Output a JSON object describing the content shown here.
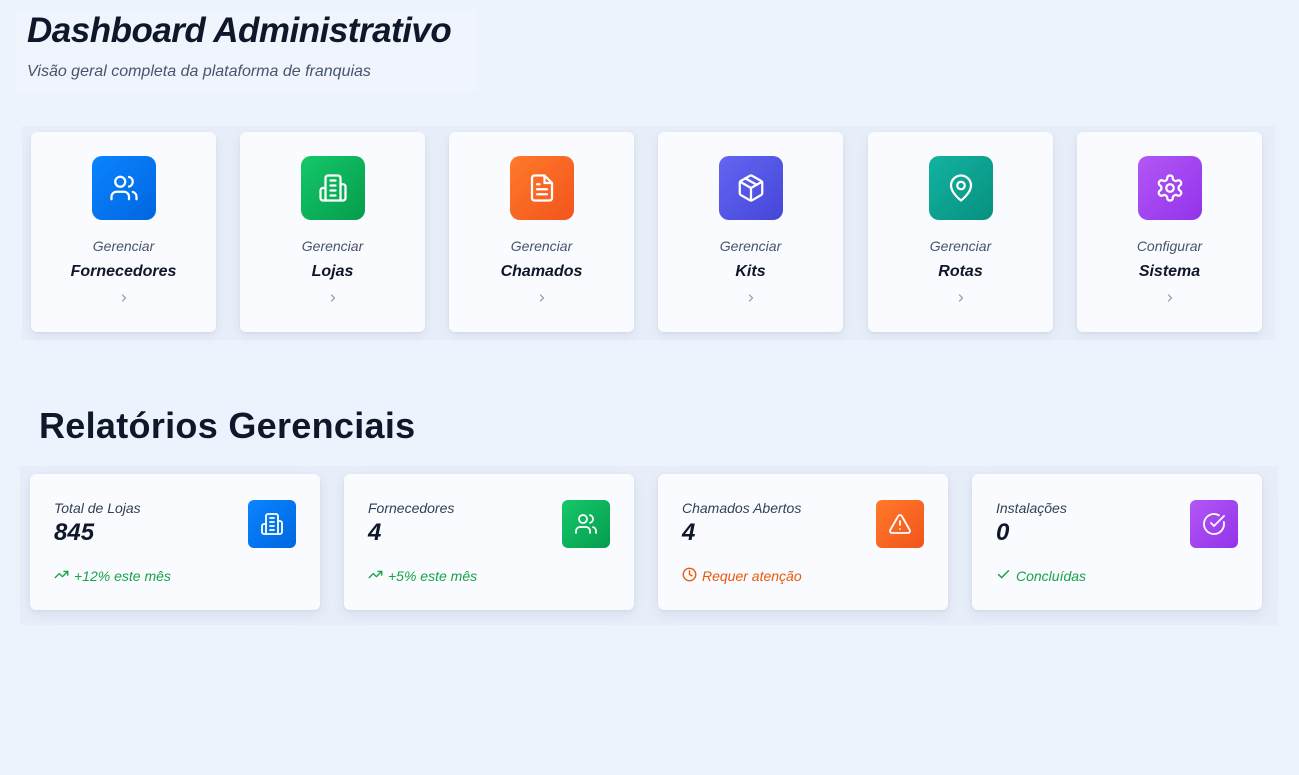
{
  "header": {
    "title": "Dashboard Administrativo",
    "subtitle": "Visão geral completa da plataforma de franquias"
  },
  "actions": [
    {
      "verb": "Gerenciar",
      "target": "Fornecedores",
      "icon": "users-icon",
      "colors": [
        "#0a84ff",
        "#0066e0"
      ]
    },
    {
      "verb": "Gerenciar",
      "target": "Lojas",
      "icon": "building-icon",
      "colors": [
        "#14c86a",
        "#069c4d"
      ]
    },
    {
      "verb": "Gerenciar",
      "target": "Chamados",
      "icon": "file-text-icon",
      "colors": [
        "#ff7a2a",
        "#f2541c"
      ]
    },
    {
      "verb": "Gerenciar",
      "target": "Kits",
      "icon": "package-icon",
      "colors": [
        "#6366f1",
        "#4546d8"
      ]
    },
    {
      "verb": "Gerenciar",
      "target": "Rotas",
      "icon": "map-pin-icon",
      "colors": [
        "#12b3a0",
        "#07907f"
      ]
    },
    {
      "verb": "Configurar",
      "target": "Sistema",
      "icon": "settings-icon",
      "colors": [
        "#b357f5",
        "#9333ea"
      ]
    }
  ],
  "reports": {
    "title": "Relatórios Gerenciais",
    "cards": [
      {
        "label": "Total de Lojas",
        "value": "845",
        "foot": "+12% este mês",
        "foot_icon": "trending-up-icon",
        "foot_color": "#16a34a",
        "icon": "building-icon",
        "colors": [
          "#0a84ff",
          "#0066e0"
        ]
      },
      {
        "label": "Fornecedores",
        "value": "4",
        "foot": "+5% este mês",
        "foot_icon": "trending-up-icon",
        "foot_color": "#16a34a",
        "icon": "users-icon",
        "colors": [
          "#14c86a",
          "#069c4d"
        ]
      },
      {
        "label": "Chamados Abertos",
        "value": "4",
        "foot": "Requer atenção",
        "foot_icon": "clock-icon",
        "foot_color": "#ea580c",
        "icon": "alert-triangle-icon",
        "colors": [
          "#ff7a2a",
          "#f2541c"
        ]
      },
      {
        "label": "Instalações",
        "value": "0",
        "foot": "Concluídas",
        "foot_icon": "check-icon",
        "foot_color": "#16a34a",
        "icon": "check-circle-icon",
        "colors": [
          "#b357f5",
          "#9333ea"
        ]
      }
    ]
  }
}
